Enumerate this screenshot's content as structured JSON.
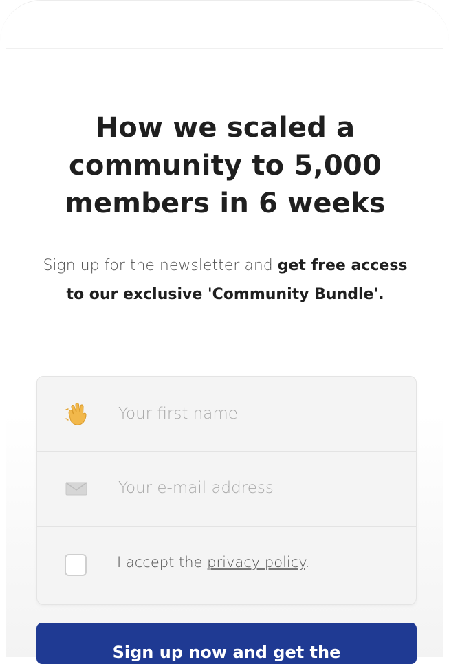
{
  "hero": {
    "headline": "How we scaled a community to 5,000 members in 6 weeks",
    "subtitle_regular": "Sign up for the newsletter and ",
    "subtitle_bold": "get free access to our exclusive 'Community Bundle'."
  },
  "form": {
    "first_name": {
      "icon": "waving-hand-icon",
      "placeholder": "Your first name",
      "value": ""
    },
    "email": {
      "icon": "envelope-icon",
      "placeholder": "Your e-mail address",
      "value": ""
    },
    "consent": {
      "text": "I accept the ",
      "link_text": "privacy policy",
      "trailing": ".",
      "checked": false
    }
  },
  "cta": {
    "label": "Sign up now and get the"
  },
  "colors": {
    "button_background": "#1f3a93",
    "headline": "#1f1f1f",
    "placeholder": "#a9a9a9",
    "card_background": "#f4f4f4"
  }
}
